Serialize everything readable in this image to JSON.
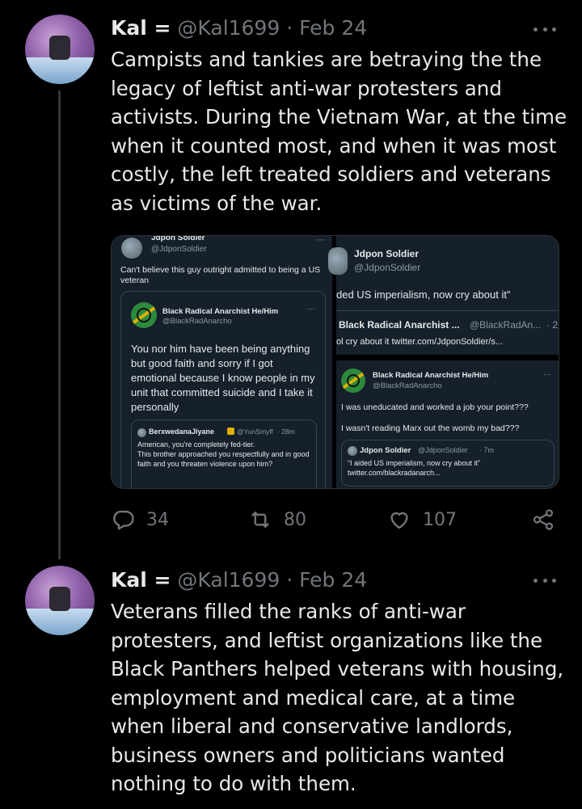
{
  "posts": [
    {
      "name": "Kal =",
      "handle": "@Kal1699",
      "date": "Feb 24",
      "text": "Campists and tankies are betraying the the legacy of leftist anti-war protesters and activists. During the Vietnam War, at the time when it counted most, and when it was most costly, the left treated soldiers and veterans as victims of the war.",
      "stats": {
        "replies": "34",
        "reposts": "80",
        "likes": "107"
      }
    },
    {
      "name": "Kal =",
      "handle": "@Kal1699",
      "date": "Feb 24",
      "text": "Veterans filled the ranks of anti-war protesters, and leftist organizations like the Black Panthers helped veterans with housing, employment and medical care, at a time when liberal and conservative landlords, business owners and politicians wanted nothing to do with them."
    }
  ],
  "media": {
    "left": {
      "author": "Jdpon Soldier",
      "handle": "@JdponSoldier",
      "text": "Can't believe this guy outright admitted to being a US veteran",
      "quote": {
        "author": "Black Radical Anarchist He/Him",
        "handle": "@BlackRadAnarcho",
        "text": "You nor him have been being anything but good faith and sorry if I got emotional because I know people in my unit that committed suicide and I take it personally",
        "inner": {
          "author": "BerxwedanaJiyane",
          "handle": "@YunSmyff",
          "time": "· 28m",
          "text": "American, you're completely fed-tier.\nThis brother approached you respectfully and in good faith and you threaten violence upon him?"
        }
      }
    },
    "right": {
      "author": "Jdpon Soldier",
      "handle": "@JdponSoldier",
      "text": "ded US imperialism, now cry about it”",
      "quote": {
        "author": "Black Radical Anarchist ...",
        "handle": "@BlackRadAn...",
        "time": "· 2",
        "text": "ol cry about it twitter.com/JdponSoldier/s..."
      },
      "reply": {
        "author": "Black Radical Anarchist He/Him",
        "handle": "@BlackRadAnarcho",
        "line1": "I was uneducated and worked a job your point???",
        "line2": "I wasn't reading Marx out the womb my bad???",
        "inner": {
          "author": "Jdpon Soldier",
          "handle": "@JdponSoldier",
          "time": "· 7m",
          "text": "“I aided US imperialism, now cry about it”\ntwitter.com/blackradanarch..."
        }
      }
    }
  },
  "icons": [
    "reply-icon",
    "repost-icon",
    "like-icon",
    "share-icon",
    "more-icon"
  ]
}
